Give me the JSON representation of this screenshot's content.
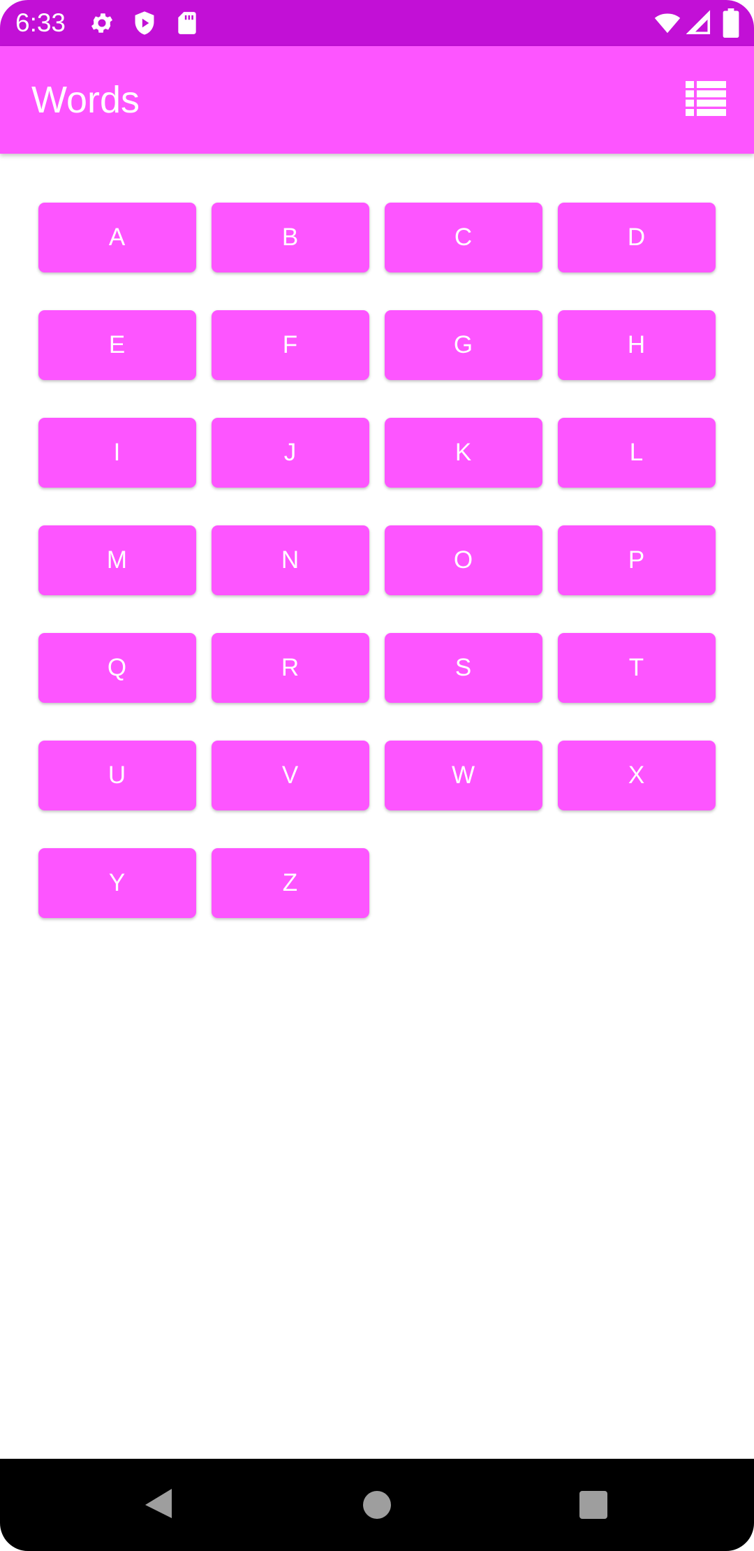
{
  "status_bar": {
    "time": "6:33",
    "icons": [
      "settings-icon",
      "play-protect-icon",
      "sd-card-icon",
      "wifi-icon",
      "signal-icon",
      "battery-icon"
    ],
    "background": "#C210D6"
  },
  "app_bar": {
    "title": "Words",
    "action_icon": "list-layout-icon",
    "background": "#FD55FF"
  },
  "letters": [
    "A",
    "B",
    "C",
    "D",
    "E",
    "F",
    "G",
    "H",
    "I",
    "J",
    "K",
    "L",
    "M",
    "N",
    "O",
    "P",
    "Q",
    "R",
    "S",
    "T",
    "U",
    "V",
    "W",
    "X",
    "Y",
    "Z"
  ],
  "button_color": "#FD55FF",
  "nav_bar": {
    "buttons": [
      "back-icon",
      "home-icon",
      "recents-icon"
    ]
  }
}
